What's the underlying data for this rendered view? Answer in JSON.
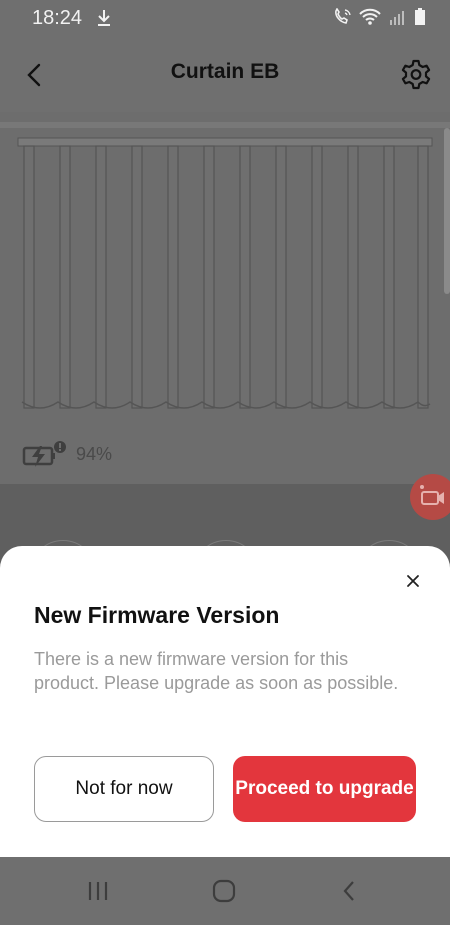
{
  "status_bar": {
    "time": "18:24",
    "icons": [
      "download-icon",
      "wifi-calling-icon",
      "wifi-icon",
      "signal-icon",
      "battery-icon"
    ]
  },
  "header": {
    "title": "Curtain EB",
    "back_icon": "chevron-left-icon",
    "settings_icon": "gear-icon"
  },
  "device": {
    "battery_percent": "94%",
    "battery_icon": "battery-charging-icon"
  },
  "floating": {
    "record_icon": "video-record-icon"
  },
  "dialog": {
    "title": "New Firmware Version",
    "message": "There is a new firmware version for this product. Please upgrade as soon as possible.",
    "secondary_label": "Not for now",
    "primary_label": "Proceed to upgrade",
    "close_icon": "close-icon",
    "primary_color": "#e3363d"
  },
  "nav_bar": {
    "icons": [
      "recent-apps-icon",
      "home-icon",
      "back-icon"
    ]
  }
}
